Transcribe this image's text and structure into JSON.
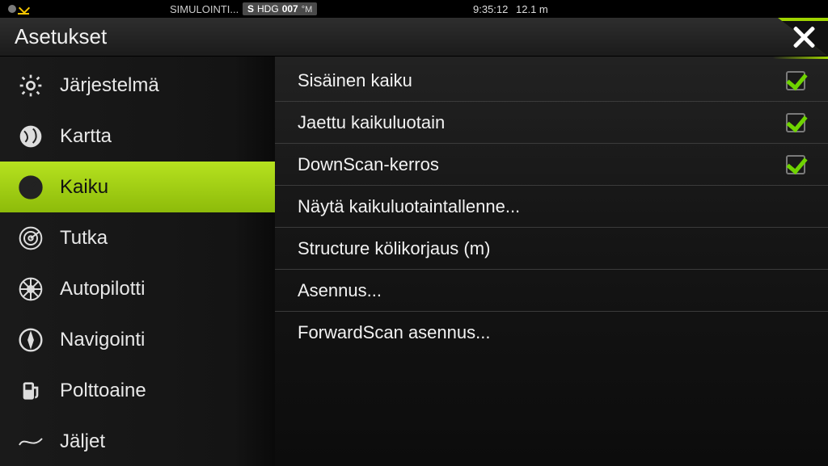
{
  "statusbar": {
    "sim": "SIMULOINTI...",
    "hdg_prefix": "S",
    "hdg_label": "HDG",
    "hdg_value": "007",
    "hdg_unit": "°M",
    "time": "9:35:12",
    "depth": "12.1 m"
  },
  "header": {
    "title": "Asetukset"
  },
  "sidebar": {
    "items": [
      {
        "id": "system",
        "label": "Järjestelmä"
      },
      {
        "id": "chart",
        "label": "Kartta"
      },
      {
        "id": "echo",
        "label": "Kaiku"
      },
      {
        "id": "radar",
        "label": "Tutka"
      },
      {
        "id": "autopilot",
        "label": "Autopilotti"
      },
      {
        "id": "nav",
        "label": "Navigointi"
      },
      {
        "id": "fuel",
        "label": "Polttoaine"
      },
      {
        "id": "tracks",
        "label": "Jäljet"
      }
    ],
    "active": "echo"
  },
  "content": {
    "rows": [
      {
        "label": "Sisäinen kaiku",
        "type": "check",
        "checked": true
      },
      {
        "label": "Jaettu kaikuluotain",
        "type": "check",
        "checked": true
      },
      {
        "label": "DownScan-kerros",
        "type": "check",
        "checked": true
      },
      {
        "label": "Näytä kaikuluotaintallenne...",
        "type": "nav"
      },
      {
        "label": "Structure kölikorjaus (m)",
        "type": "nav"
      },
      {
        "label": "Asennus...",
        "type": "nav"
      },
      {
        "label": "ForwardScan asennus...",
        "type": "nav"
      }
    ]
  }
}
